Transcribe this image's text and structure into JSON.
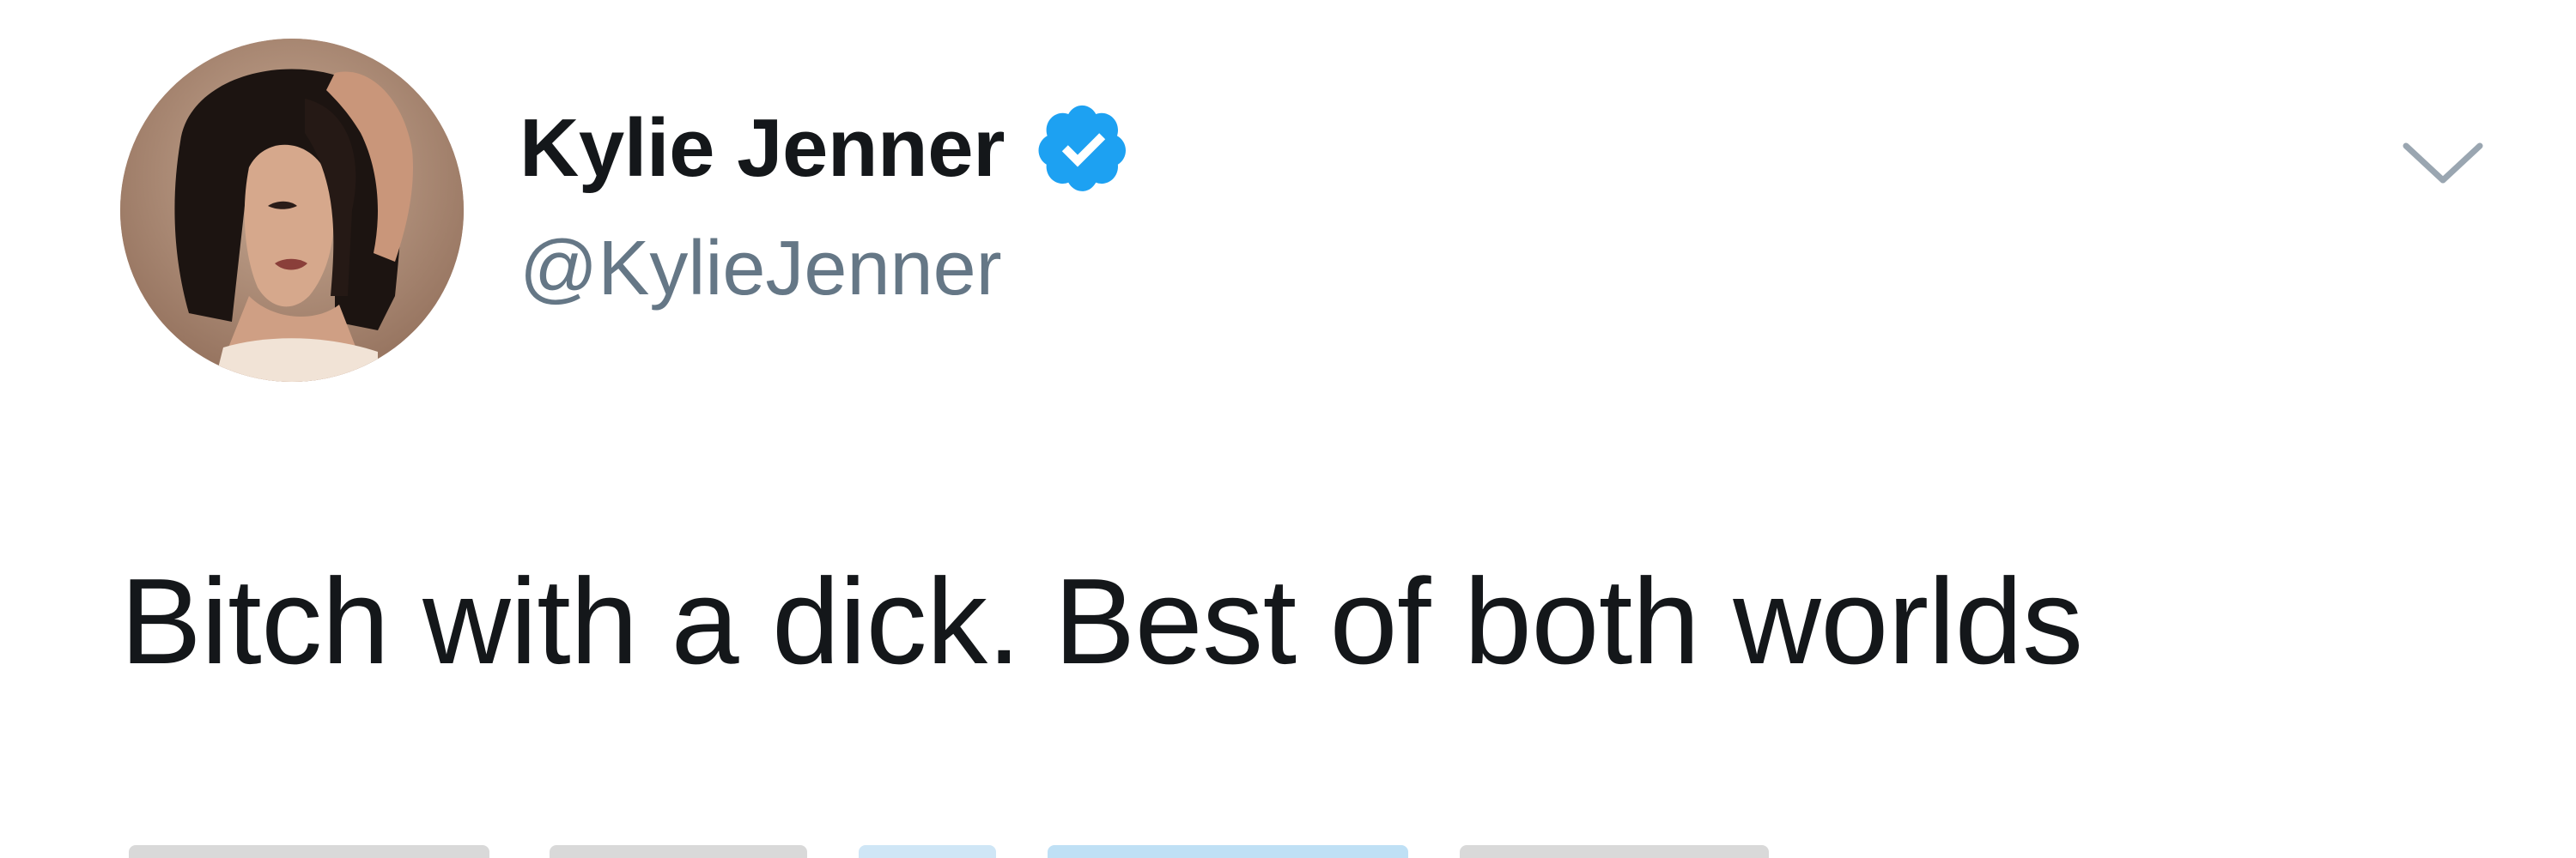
{
  "tweet": {
    "display_name": "Kylie Jenner",
    "handle": "@KylieJenner",
    "text": "Bitch with a dick. Best of both worlds",
    "verified": true
  },
  "colors": {
    "text_primary": "#14171a",
    "text_secondary": "#657786",
    "verified_blue": "#1da1f2",
    "background": "#ffffff"
  },
  "icons": {
    "verified": "verified-badge-icon",
    "menu": "chevron-down-icon"
  }
}
